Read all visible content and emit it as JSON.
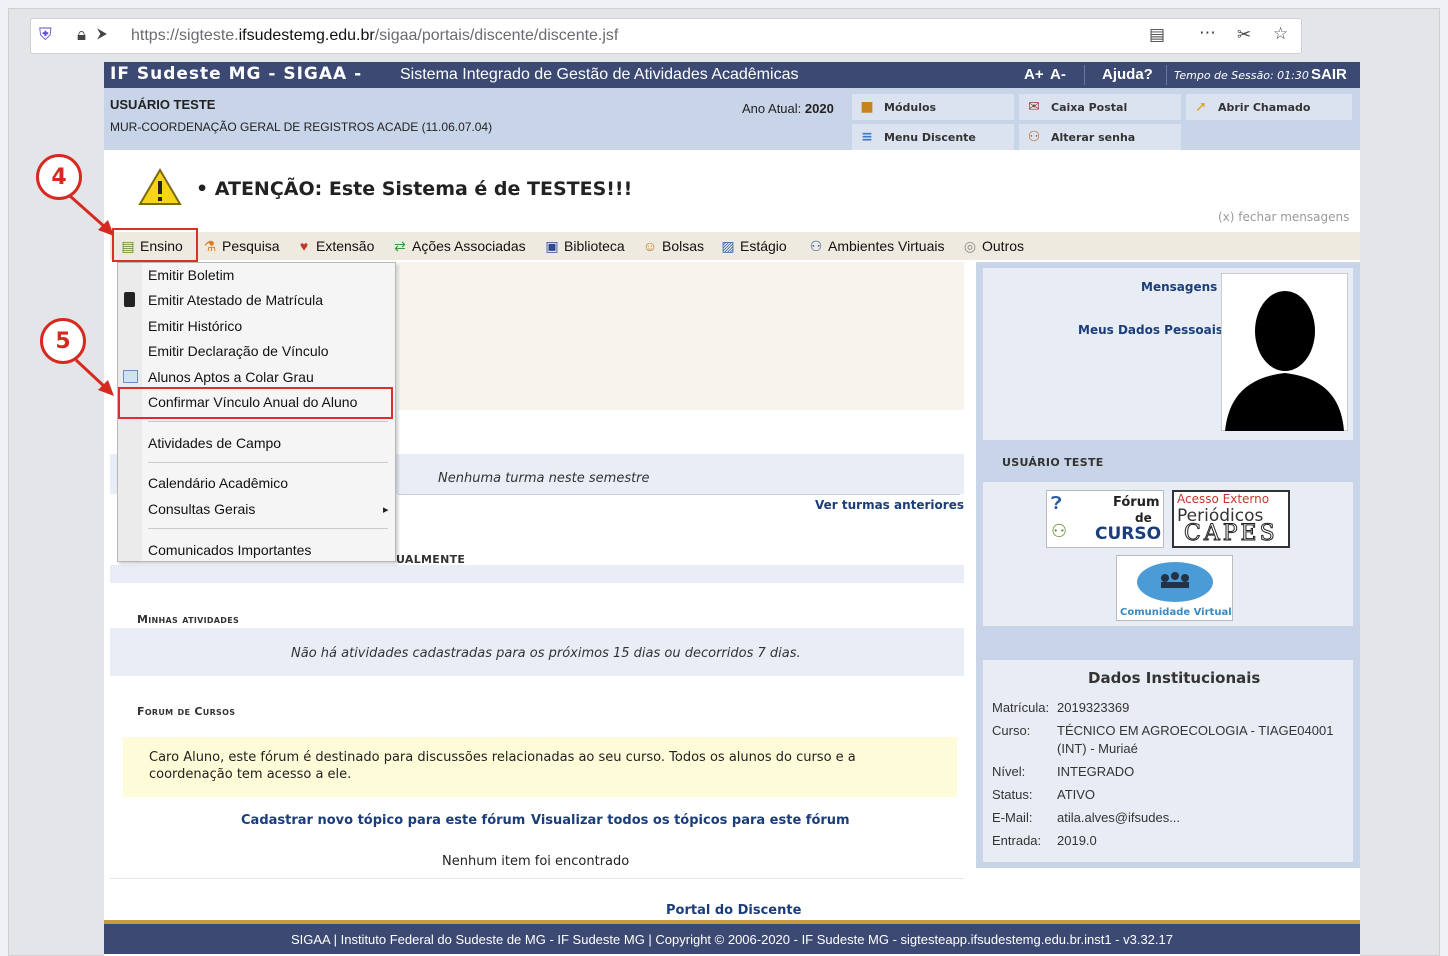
{
  "browser": {
    "url_prefix": "https://sigteste.",
    "url_domain": "ifsudestemg.edu.br",
    "url_path": "/sigaa/portais/discente/discente.jsf"
  },
  "header": {
    "logo": "IF Sudeste MG - SIGAA -",
    "subtitle": "Sistema Integrado de Gestão de Atividades Acadêmicas",
    "font_up": "A+",
    "font_down": "A-",
    "help": "Ajuda?",
    "session_label": "Tempo de Sessão: 01:30",
    "logout": "SAIR"
  },
  "userbar": {
    "name": "USUÁRIO TESTE",
    "unit": "MUR-COORDENAÇÃO GERAL DE REGISTROS ACADE (11.06.07.04)",
    "ano_label": "Ano Atual:",
    "ano_value": "2020",
    "buttons": {
      "modulos": "Módulos",
      "caixa_postal": "Caixa Postal",
      "abrir_chamado": "Abrir Chamado",
      "menu_discente": "Menu Discente",
      "alterar_senha": "Alterar senha"
    }
  },
  "warning": {
    "text": "• ATENÇÃO: Este Sistema é de TESTES!!!",
    "close": "(x) fechar mensagens"
  },
  "menubar": {
    "ensino": "Ensino",
    "pesquisa": "Pesquisa",
    "extensao": "Extensão",
    "acoes": "Ações Associadas",
    "biblioteca": "Biblioteca",
    "bolsas": "Bolsas",
    "estagio": "Estágio",
    "ambientes": "Ambientes Virtuais",
    "outros": "Outros"
  },
  "dropdown": {
    "boletim": "Emitir Boletim",
    "atestado": "Emitir Atestado de Matrícula",
    "historico": "Emitir Histórico",
    "declaracao": "Emitir Declaração de Vínculo",
    "aptos": "Alunos Aptos a Colar Grau",
    "confirmar": "Confirmar Vínculo Anual do Aluno",
    "atividades_campo": "Atividades de Campo",
    "calendario": "Calendário Acadêmico",
    "consultas": "Consultas Gerais",
    "comunicados": "Comunicados Importantes"
  },
  "main": {
    "nenhuma_turma": "Nenhuma turma neste semestre",
    "ver_turmas": "Ver turmas anteriores",
    "partial_title": "UALMENTE",
    "minhas_atividades": "Minhas atividades",
    "sem_atividades": "Não há atividades cadastradas para os próximos 15 dias ou decorridos 7 dias.",
    "forum_title": "Forum de Cursos",
    "forum_note": "Caro Aluno, este fórum é destinado para discussões relacionadas ao seu curso. Todos os alunos do curso e a coordenação tem acesso a ele.",
    "cadastrar_topico": "Cadastrar novo tópico para este fórum",
    "visualizar_topicos": "Visualizar todos os tópicos para este fórum",
    "nenhum_item": "Nenhum item foi encontrado"
  },
  "sidebar": {
    "mensagens": "Mensagens",
    "meus_dados": "Meus Dados Pessoais",
    "user_name": "USUÁRIO TESTE",
    "forum_badge": {
      "line1": "Fórum",
      "line2": "de",
      "line3": "CURSO"
    },
    "capes_badge": {
      "line1": "Acesso Externo",
      "line2": "Periódicos",
      "line3": "CAPES"
    },
    "comunidade_badge": "Comunidade Virtual",
    "dados_title": "Dados Institucionais",
    "fields": [
      {
        "label": "Matrícula:",
        "value": "2019323369"
      },
      {
        "label": "Curso:",
        "value": "TÉCNICO EM AGROECOLOGIA - TIAGE04001",
        "value2": "(INT) - Muriaé"
      },
      {
        "label": "Nível:",
        "value": "INTEGRADO"
      },
      {
        "label": "Status:",
        "value": "ATIVO"
      },
      {
        "label": "E-Mail:",
        "value": "atila.alves@ifsudes..."
      },
      {
        "label": "Entrada:",
        "value": "2019.0"
      }
    ]
  },
  "footer": {
    "portal": "Portal do Discente",
    "text": "SIGAA | Instituto Federal do Sudeste de MG - IF Sudeste MG | Copyright © 2006-2020 - IF Sudeste MG - sigtesteapp.ifsudestemg.edu.br.inst1 - v3.32.17"
  },
  "annotations": {
    "step4": "4",
    "step5": "5"
  },
  "colors": {
    "header_bg": "#3c4a73",
    "userbar_bg": "#c8d4e8",
    "link": "#1b3d7a",
    "annotation_red": "#d62a20"
  }
}
